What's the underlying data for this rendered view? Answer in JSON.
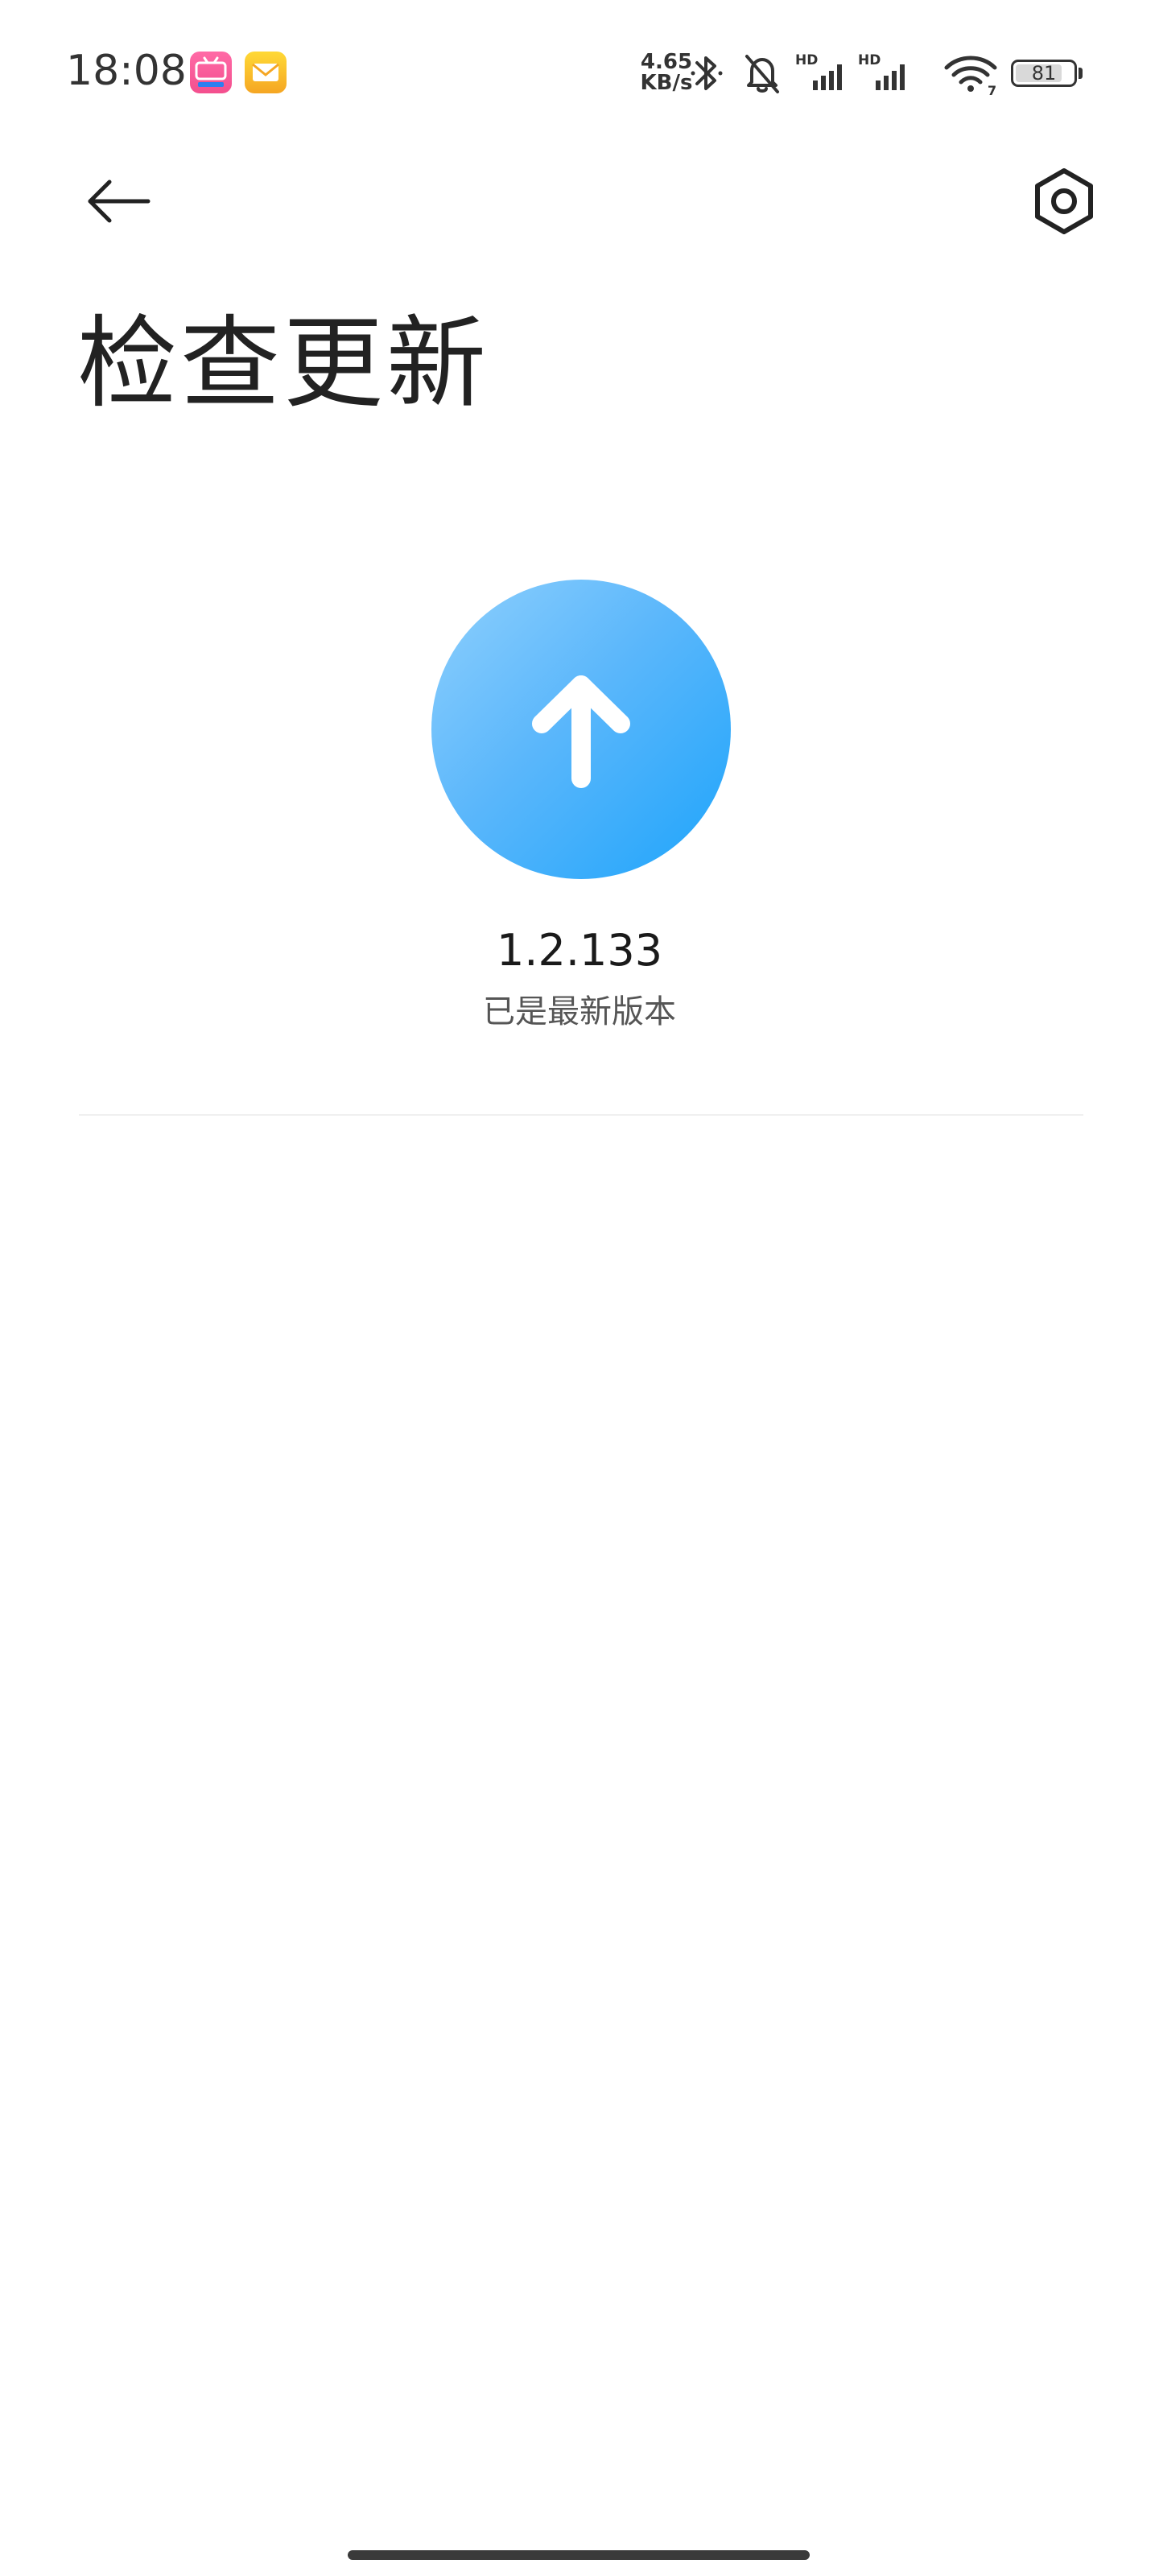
{
  "status_bar": {
    "time": "18:08",
    "net_speed_value": "4.65",
    "net_speed_unit": "KB/s",
    "signal_1_label": "HD",
    "signal_2_label": "HD",
    "wifi_label": "7",
    "battery_level": "81",
    "notification_icons": [
      "bilibili-icon",
      "mail-icon"
    ]
  },
  "header": {
    "back_icon": "arrow-left-icon",
    "settings_icon": "hexagon-gear-icon",
    "title": "检查更新"
  },
  "update": {
    "icon": "arrow-up-icon",
    "version": "1.2.133",
    "status": "已是最新版本"
  },
  "colors": {
    "accent_start": "#8fd0fd",
    "accent_end": "#1ea4fb"
  }
}
